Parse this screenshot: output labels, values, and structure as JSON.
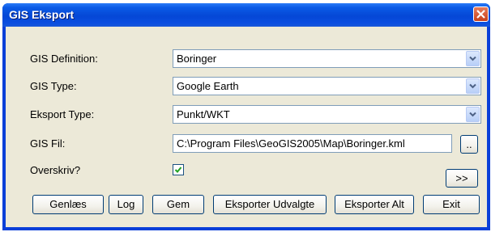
{
  "window": {
    "title": "GIS Eksport"
  },
  "fields": {
    "definition": {
      "label": "GIS Definition:",
      "value": "Boringer"
    },
    "type": {
      "label": "GIS Type:",
      "value": "Google Earth"
    },
    "export_type": {
      "label": "Eksport Type:",
      "value": "Punkt/WKT"
    },
    "file": {
      "label": "GIS Fil:",
      "value": "C:\\Program Files\\GeoGIS2005\\Map\\Boringer.kml",
      "browse_label": ".."
    },
    "overwrite": {
      "label": "Overskriv?",
      "checked": true
    }
  },
  "buttons": {
    "more": ">>",
    "reload": "Genlæs",
    "log": "Log",
    "save": "Gem",
    "export_selected": "Eksporter Udvalgte",
    "export_all": "Eksporter Alt",
    "exit": "Exit"
  },
  "colors": {
    "titlebar": "#0547d6",
    "dialog": "#ece9d8",
    "checkmark": "#21a121"
  },
  "icons": {
    "close": "close-icon",
    "dropdown": "chevron-down-icon",
    "check": "check-icon"
  }
}
